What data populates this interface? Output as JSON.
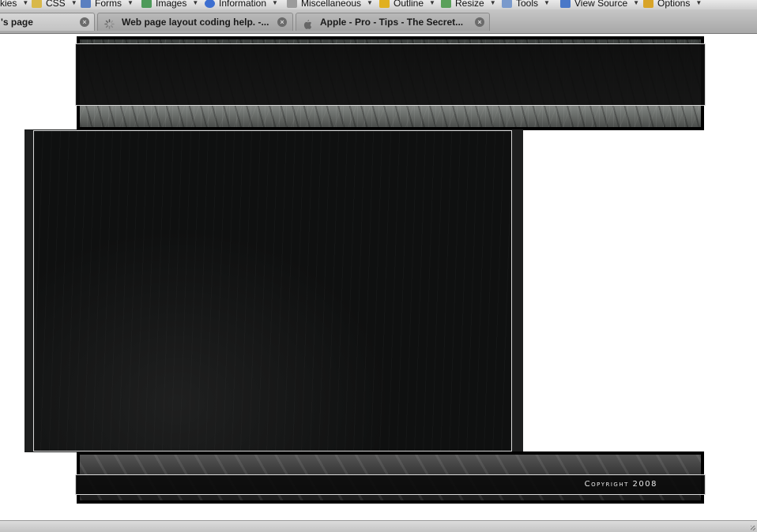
{
  "devtoolbar": {
    "items": [
      {
        "label": "kies",
        "icon": "cookies-icon"
      },
      {
        "label": "CSS",
        "icon": "css-icon"
      },
      {
        "label": "Forms",
        "icon": "forms-icon"
      },
      {
        "label": "Images",
        "icon": "images-icon"
      },
      {
        "label": "Information",
        "icon": "information-icon"
      },
      {
        "label": "Miscellaneous",
        "icon": "miscellaneous-icon"
      },
      {
        "label": "Outline",
        "icon": "outline-icon"
      },
      {
        "label": "Resize",
        "icon": "resize-icon"
      },
      {
        "label": "Tools",
        "icon": "tools-icon"
      },
      {
        "label": "View Source",
        "icon": "view-source-icon"
      },
      {
        "label": "Options",
        "icon": "options-icon"
      }
    ]
  },
  "tabs": [
    {
      "title": "'s page",
      "active": true
    },
    {
      "title": "Web page layout coding help. -...",
      "active": false,
      "loading": true
    },
    {
      "title": "Apple - Pro - Tips - The Secret...",
      "active": false
    }
  ],
  "page": {
    "footer": {
      "copyright": "Copyright 2008"
    }
  }
}
